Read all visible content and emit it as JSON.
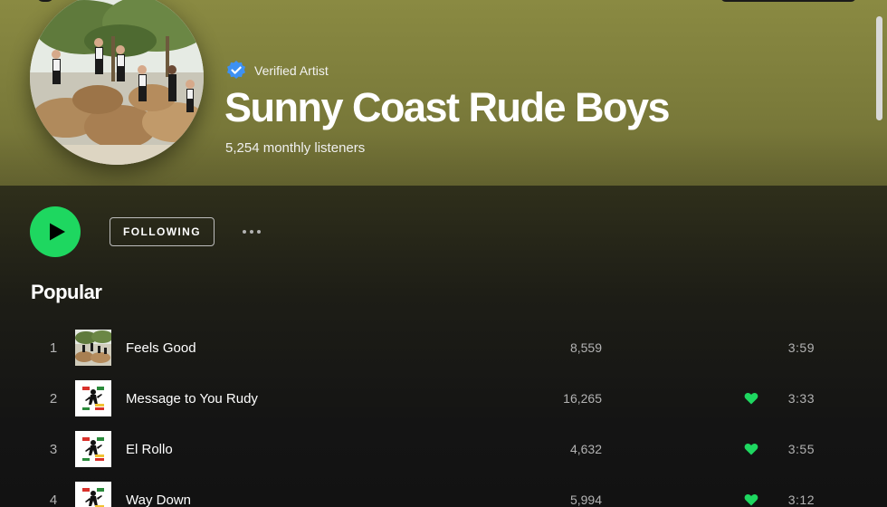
{
  "artist": {
    "verified_label": "Verified Artist",
    "name": "Sunny Coast Rude Boys",
    "monthly_listeners": "5,254 monthly listeners"
  },
  "actions": {
    "follow_label": "FOLLOWING"
  },
  "popular": {
    "title": "Popular",
    "tracks": [
      {
        "number": "1",
        "title": "Feels Good",
        "plays": "8,559",
        "duration": "3:59",
        "liked": false,
        "art": "photo"
      },
      {
        "number": "2",
        "title": "Message to You Rudy",
        "plays": "16,265",
        "duration": "3:33",
        "liked": true,
        "art": "logo"
      },
      {
        "number": "3",
        "title": "El Rollo",
        "plays": "4,632",
        "duration": "3:55",
        "liked": true,
        "art": "logo"
      },
      {
        "number": "4",
        "title": "Way Down",
        "plays": "5,994",
        "duration": "3:12",
        "liked": true,
        "art": "logo"
      }
    ]
  },
  "icons": {
    "verified": "verified-badge-icon",
    "play": "play-icon",
    "more": "more-options-icon",
    "heart": "heart-filled-icon"
  },
  "colors": {
    "accent_green": "#1ed760",
    "verified_blue": "#3d91f4",
    "header_olive": "#8a8a42",
    "background": "#121212"
  }
}
